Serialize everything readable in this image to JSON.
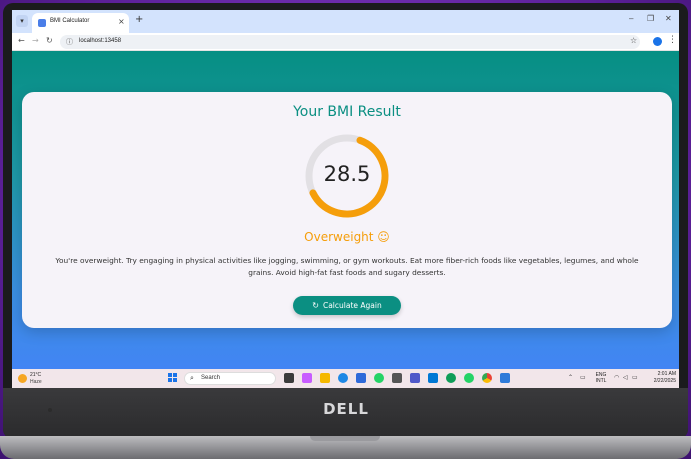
{
  "browser": {
    "tab_title": "BMI Calculator",
    "tab_close": "×",
    "new_tab": "+",
    "url": "localhost:13458",
    "minimize": "–",
    "maximize": "❐",
    "close": "✕"
  },
  "result": {
    "title": "Your BMI Result",
    "bmi": "28.5",
    "gauge_fraction": 0.62,
    "category": "Overweight ☺",
    "advice": "You're overweight. Try engaging in physical activities like jogging, swimming, or gym workouts. Eat more fiber-rich foods like vegetables, legumes, and whole grains. Avoid high-fat fast foods and sugary desserts.",
    "button_label": "Calculate Again"
  },
  "colors": {
    "accent": "#0b8f82",
    "warning": "#f59e0b"
  },
  "taskbar": {
    "weather_temp": "21°C",
    "weather_desc": "Haze",
    "search_placeholder": "Search",
    "lang_top": "ENG",
    "lang_bottom": "INTL",
    "time": "2:01 AM",
    "date": "2/22/2025"
  },
  "laptop": {
    "brand": "DELL"
  }
}
